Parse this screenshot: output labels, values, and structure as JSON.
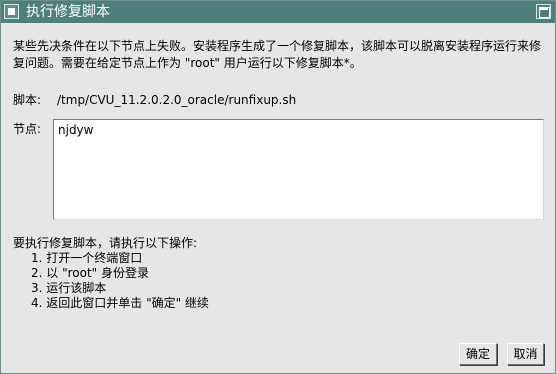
{
  "window": {
    "title": "执行修复脚本"
  },
  "intro_text": "某些先决条件在以下节点上失败。安装程序生成了一个修复脚本，该脚本可以脱离安装程序运行来修复问题。需要在给定节点上作为 \"root\" 用户运行以下修复脚本*。",
  "script": {
    "label": "脚本:",
    "path": "/tmp/CVU_11.2.0.2.0_oracle/runfixup.sh"
  },
  "nodes": {
    "label": "节点:",
    "value": "njdyw"
  },
  "instructions": {
    "heading": "要执行修复脚本，请执行以下操作:",
    "steps": [
      "1.  打开一个终端窗口",
      "2.  以 \"root\" 身份登录",
      "3.  运行该脚本",
      "4.  返回此窗口并单击 \"确定\" 继续"
    ]
  },
  "buttons": {
    "ok": "确定",
    "cancel": "取消"
  },
  "colors": {
    "titlebar": "#4f7f7a",
    "background": "#e6e6e6"
  }
}
